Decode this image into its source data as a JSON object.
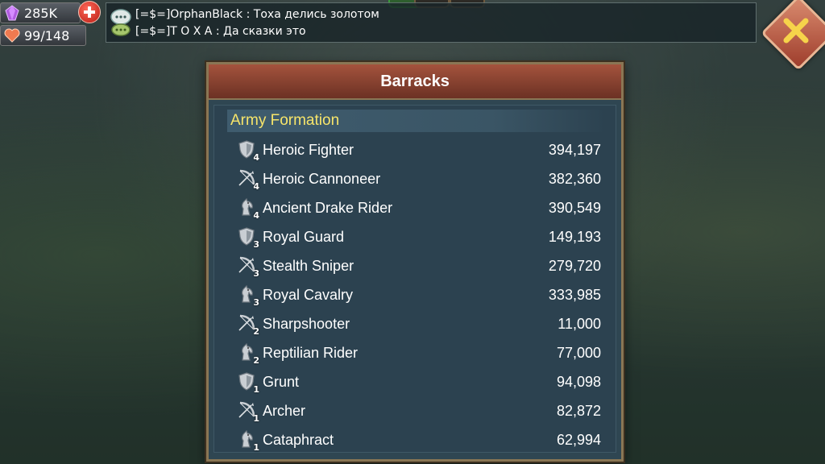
{
  "resources": {
    "gems": "285K",
    "stamina": "99/148"
  },
  "chat": {
    "messages": [
      {
        "sender": "[=$=]OrphanBlack",
        "separator": ":",
        "text": "Тоха делись золотом"
      },
      {
        "sender": "[=$=]Т О Х А",
        "separator": ":",
        "text": "Да сказки это"
      }
    ]
  },
  "panel": {
    "title": "Barracks",
    "section_title": "Army Formation",
    "troops": [
      {
        "name": "Heroic Fighter",
        "tier": "4",
        "type": "infantry",
        "count": "394,197"
      },
      {
        "name": "Heroic Cannoneer",
        "tier": "4",
        "type": "ranged",
        "count": "382,360"
      },
      {
        "name": "Ancient Drake Rider",
        "tier": "4",
        "type": "cavalry",
        "count": "390,549"
      },
      {
        "name": "Royal Guard",
        "tier": "3",
        "type": "infantry",
        "count": "149,193"
      },
      {
        "name": "Stealth Sniper",
        "tier": "3",
        "type": "ranged",
        "count": "279,720"
      },
      {
        "name": "Royal Cavalry",
        "tier": "3",
        "type": "cavalry",
        "count": "333,985"
      },
      {
        "name": "Sharpshooter",
        "tier": "2",
        "type": "ranged",
        "count": "11,000"
      },
      {
        "name": "Reptilian Rider",
        "tier": "2",
        "type": "cavalry",
        "count": "77,000"
      },
      {
        "name": "Grunt",
        "tier": "1",
        "type": "infantry",
        "count": "94,098"
      },
      {
        "name": "Archer",
        "tier": "1",
        "type": "ranged",
        "count": "82,872"
      },
      {
        "name": "Cataphract",
        "tier": "1",
        "type": "cavalry",
        "count": "62,994"
      }
    ]
  },
  "icons": {
    "gems": "gem-icon",
    "stamina": "heart-icon",
    "add": "plus-icon",
    "chat": "chat-bubble-icon",
    "close": "close-icon",
    "infantry": "shield-icon",
    "ranged": "bow-icon",
    "cavalry": "horse-icon"
  }
}
